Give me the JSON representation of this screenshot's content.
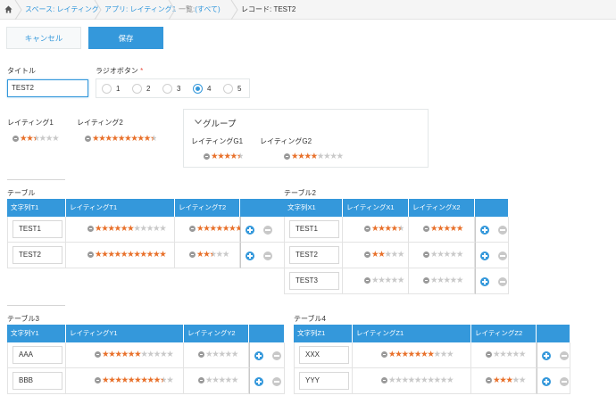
{
  "breadcrumb": {
    "home_icon": "home-icon",
    "space": "スペース: レイティング",
    "app": "アプリ: レイティング1",
    "list_prefix": "一覧:",
    "list_link": "(すべて)",
    "record": "レコード: TEST2"
  },
  "toolbar": {
    "cancel_label": "キャンセル",
    "save_label": "保存"
  },
  "fields": {
    "title_label": "タイトル",
    "title_value": "TEST2",
    "radio_label": "ラジオボタン",
    "required_mark": "*",
    "radio_options": [
      "1",
      "2",
      "3",
      "4",
      "5"
    ],
    "radio_selected": "4",
    "rating1_label": "レイティング1",
    "rating1_value": 2.5,
    "rating1_max": 6,
    "rating2_label": "レイティング2",
    "rating2_value": 9.5,
    "rating2_max": 10,
    "group_label": "グループ",
    "ratingG1_label": "レイティングG1",
    "ratingG1_value": 4.5,
    "ratingG1_max": 5,
    "ratingG2_label": "レイティングG2",
    "ratingG2_value": 4,
    "ratingG2_max": 8
  },
  "table1": {
    "title": "テーブル",
    "headers": [
      "文字列T1",
      "レイティングT1",
      "レイティングT2"
    ],
    "rows": [
      {
        "text": "TEST1",
        "r1": 6,
        "r1max": 11,
        "r2": 7,
        "r2max": 7
      },
      {
        "text": "TEST2",
        "r1": 11,
        "r1max": 11,
        "r2": 2.5,
        "r2max": 5
      }
    ]
  },
  "table2": {
    "title": "テーブル2",
    "headers": [
      "文字列X1",
      "レイティングX1",
      "レイティングX2"
    ],
    "rows": [
      {
        "text": "TEST1",
        "r1": 4.5,
        "r1max": 5,
        "r2": 5,
        "r2max": 5
      },
      {
        "text": "TEST2",
        "r1": 2,
        "r1max": 5,
        "r2": 0,
        "r2max": 5
      },
      {
        "text": "TEST3",
        "r1": 0,
        "r1max": 5,
        "r2": 0,
        "r2max": 5
      }
    ]
  },
  "table3": {
    "title": "テーブル3",
    "headers": [
      "文字列Y1",
      "レイティングY1",
      "レイティングY2"
    ],
    "rows": [
      {
        "text": "AAA",
        "r1": 6,
        "r1max": 11,
        "r2": 0,
        "r2max": 5
      },
      {
        "text": "BBB",
        "r1": 9.5,
        "r1max": 11,
        "r2": 0,
        "r2max": 5
      }
    ]
  },
  "table4": {
    "title": "テーブル4",
    "headers": [
      "文字列Z1",
      "レイティングZ1",
      "レイティングZ2"
    ],
    "rows": [
      {
        "text": "XXX",
        "r1": 7,
        "r1max": 10,
        "r2": 0,
        "r2max": 5
      },
      {
        "text": "YYY",
        "r1": 0,
        "r1max": 10,
        "r2": 3,
        "r2max": 5
      }
    ]
  },
  "colors": {
    "accent": "#3498db",
    "star_on": "#e8702a",
    "star_off": "#c9c9c9",
    "required": "#e74c3c"
  }
}
